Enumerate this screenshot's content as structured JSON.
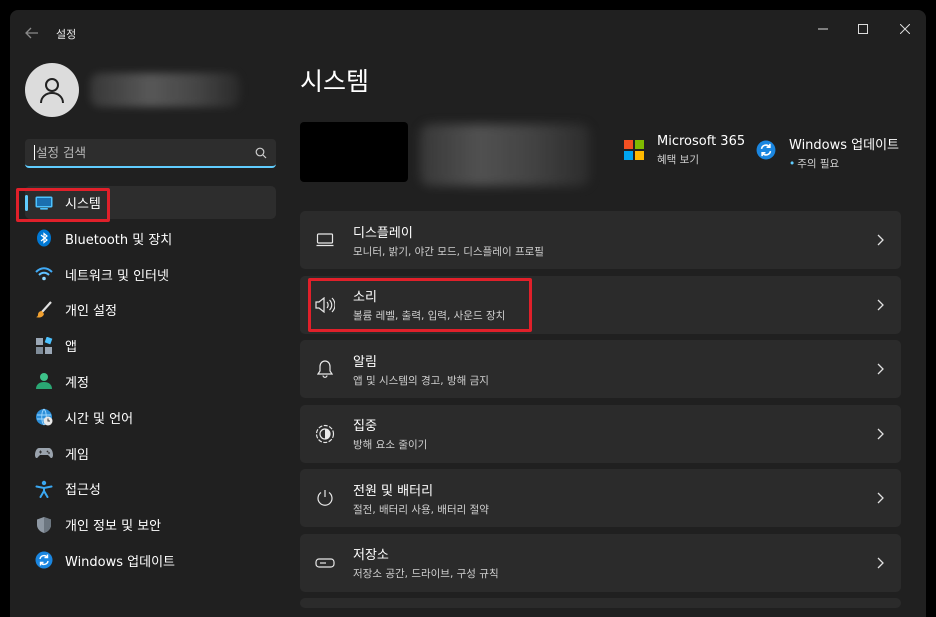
{
  "window": {
    "app_title": "설정",
    "back_icon": "back-arrow-icon"
  },
  "sidebar": {
    "search_placeholder": "설정 검색",
    "items": [
      {
        "label": "시스템",
        "icon": "monitor-icon",
        "selected": true
      },
      {
        "label": "Bluetooth 및 장치",
        "icon": "bluetooth-icon"
      },
      {
        "label": "네트워크 및 인터넷",
        "icon": "wifi-icon"
      },
      {
        "label": "개인 설정",
        "icon": "paintbrush-icon"
      },
      {
        "label": "앱",
        "icon": "apps-icon"
      },
      {
        "label": "계정",
        "icon": "account-icon"
      },
      {
        "label": "시간 및 언어",
        "icon": "globe-clock-icon"
      },
      {
        "label": "게임",
        "icon": "gamepad-icon"
      },
      {
        "label": "접근성",
        "icon": "accessibility-icon"
      },
      {
        "label": "개인 정보 및 보안",
        "icon": "shield-icon"
      },
      {
        "label": "Windows 업데이트",
        "icon": "update-icon"
      }
    ]
  },
  "main": {
    "title": "시스템",
    "promos": [
      {
        "title": "Microsoft 365",
        "subtitle": "혜택 보기",
        "icon": "microsoft-logo-icon"
      },
      {
        "title": "Windows 업데이트",
        "subtitle": "주의 필요",
        "icon": "update-icon"
      }
    ],
    "cards": [
      {
        "title": "디스플레이",
        "subtitle": "모니터, 밝기, 야간 모드, 디스플레이 프로필",
        "icon": "display-icon"
      },
      {
        "title": "소리",
        "subtitle": "볼륨 레벨, 출력, 입력, 사운드 장치",
        "icon": "speaker-icon"
      },
      {
        "title": "알림",
        "subtitle": "앱 및 시스템의 경고, 방해 금지",
        "icon": "bell-icon"
      },
      {
        "title": "집중",
        "subtitle": "방해 요소 줄이기",
        "icon": "focus-icon"
      },
      {
        "title": "전원 및 배터리",
        "subtitle": "절전, 배터리 사용, 배터리 절약",
        "icon": "power-icon"
      },
      {
        "title": "저장소",
        "subtitle": "저장소 공간, 드라이브, 구성 규칙",
        "icon": "storage-icon"
      }
    ]
  },
  "colors": {
    "accent": "#60cdff",
    "highlight_box": "#e0202a",
    "window_bg": "#202020",
    "card_bg": "#2b2b2b"
  }
}
